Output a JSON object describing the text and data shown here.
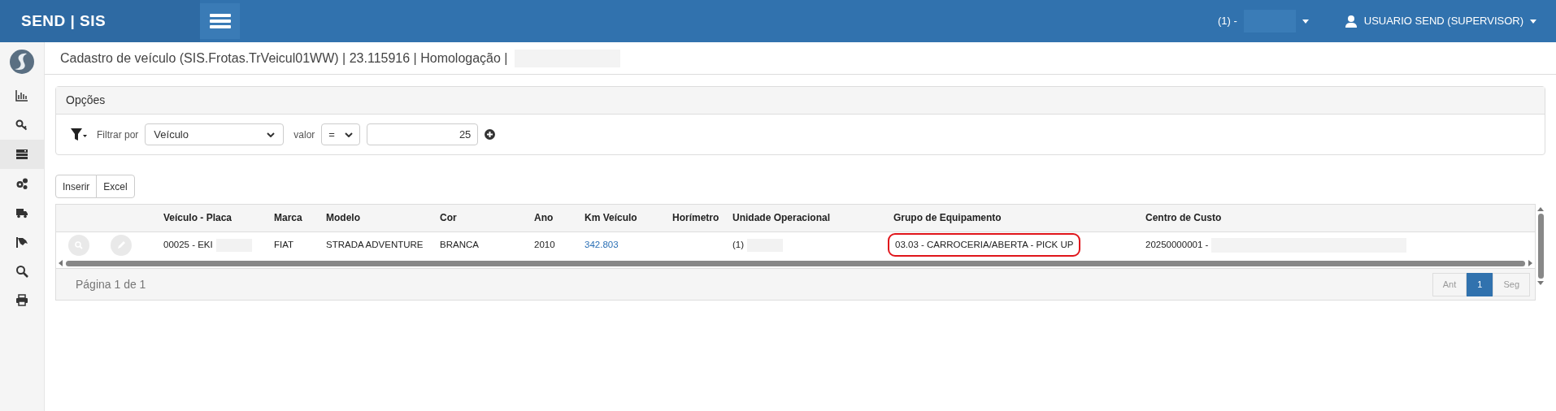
{
  "brand": "SEND | SIS",
  "topbar": {
    "company": "(1) -",
    "user": "USUARIO SEND (SUPERVISOR)"
  },
  "sidebar": {
    "items": [
      {
        "kind": "chart",
        "selected": false
      },
      {
        "kind": "key",
        "selected": false
      },
      {
        "kind": "server",
        "selected": true
      },
      {
        "kind": "gears",
        "selected": false
      },
      {
        "kind": "truck",
        "selected": false
      },
      {
        "kind": "hand",
        "selected": false
      },
      {
        "kind": "search",
        "selected": false
      },
      {
        "kind": "print",
        "selected": false
      }
    ]
  },
  "page_title": "Cadastro de veículo (SIS.Frotas.TrVeicul01WW) | 23.115916 | Homologação |",
  "options": {
    "title": "Opções",
    "filter_label": "Filtrar por",
    "filter_field": "Veículo",
    "value_label": "valor",
    "operator": "=",
    "value": "25"
  },
  "actions": [
    "Inserir",
    "Excel"
  ],
  "table": {
    "columns": [
      "Veículo - Placa",
      "Marca",
      "Modelo",
      "Cor",
      "Ano",
      "Km Veículo",
      "Horímetro",
      "Unidade Operacional",
      "Grupo de Equipamento",
      "Centro de Custo"
    ],
    "rows": [
      {
        "cells": [
          {
            "kind": "text",
            "text": "00025 - EKI"
          },
          {
            "kind": "text",
            "text": "FIAT"
          },
          {
            "kind": "text",
            "text": "STRADA ADVENTURE"
          },
          {
            "kind": "text",
            "text": "BRANCA"
          },
          {
            "kind": "text",
            "text": "2010"
          },
          {
            "kind": "link",
            "text": "342.803"
          },
          {
            "kind": "empty"
          },
          {
            "kind": "text",
            "text": "(1)"
          },
          {
            "kind": "circled",
            "text": "03.03 - CARROCERIA/ABERTA - PICK UP"
          },
          {
            "kind": "text",
            "text": "20250000001 -"
          }
        ]
      }
    ]
  },
  "pager": {
    "info": "Página 1 de 1",
    "buttons": [
      {
        "label": "Ant",
        "selected": false
      },
      {
        "label": "1",
        "selected": true
      },
      {
        "label": "Seg",
        "selected": false
      }
    ]
  }
}
